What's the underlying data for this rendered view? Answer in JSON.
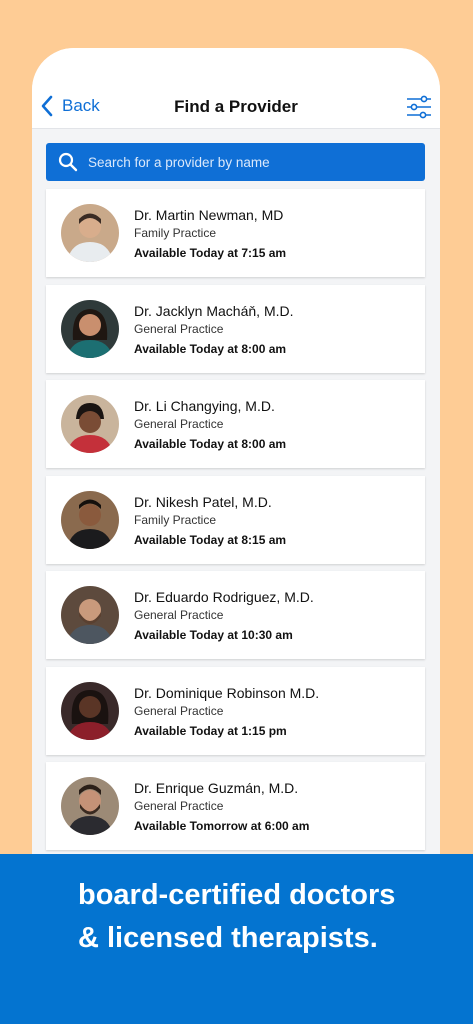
{
  "colors": {
    "page_background": "#fecc95",
    "accent": "#0f6fd6",
    "banner": "#0474d0"
  },
  "navbar": {
    "back_label": "Back",
    "title": "Find a Provider",
    "back_icon": "chevron-left-icon",
    "filter_icon": "sliders-icon"
  },
  "search": {
    "placeholder": "Search for a provider by name",
    "icon": "search-icon"
  },
  "providers": [
    {
      "name": "Dr. Martin Newman, MD",
      "specialty": "Family Practice",
      "availability": "Available Today at 7:15 am"
    },
    {
      "name": "Dr. Jacklyn Macháň, M.D.",
      "specialty": "General Practice",
      "availability": "Available Today at 8:00 am"
    },
    {
      "name": "Dr. Li Changying, M.D.",
      "specialty": "General Practice",
      "availability": "Available Today at 8:00 am"
    },
    {
      "name": "Dr. Nikesh Patel, M.D.",
      "specialty": "Family Practice",
      "availability": "Available Today at 8:15 am"
    },
    {
      "name": "Dr. Eduardo Rodriguez, M.D.",
      "specialty": "General Practice",
      "availability": "Available Today at 10:30 am"
    },
    {
      "name": "Dr. Dominique Robinson M.D.",
      "specialty": "General Practice",
      "availability": "Available Today at 1:15 pm"
    },
    {
      "name": "Dr. Enrique Guzmán, M.D.",
      "specialty": "General Practice",
      "availability": "Available Tomorrow at 6:00 am"
    }
  ],
  "banner": {
    "line1": "board-certified doctors",
    "line2": "& licensed therapists."
  }
}
